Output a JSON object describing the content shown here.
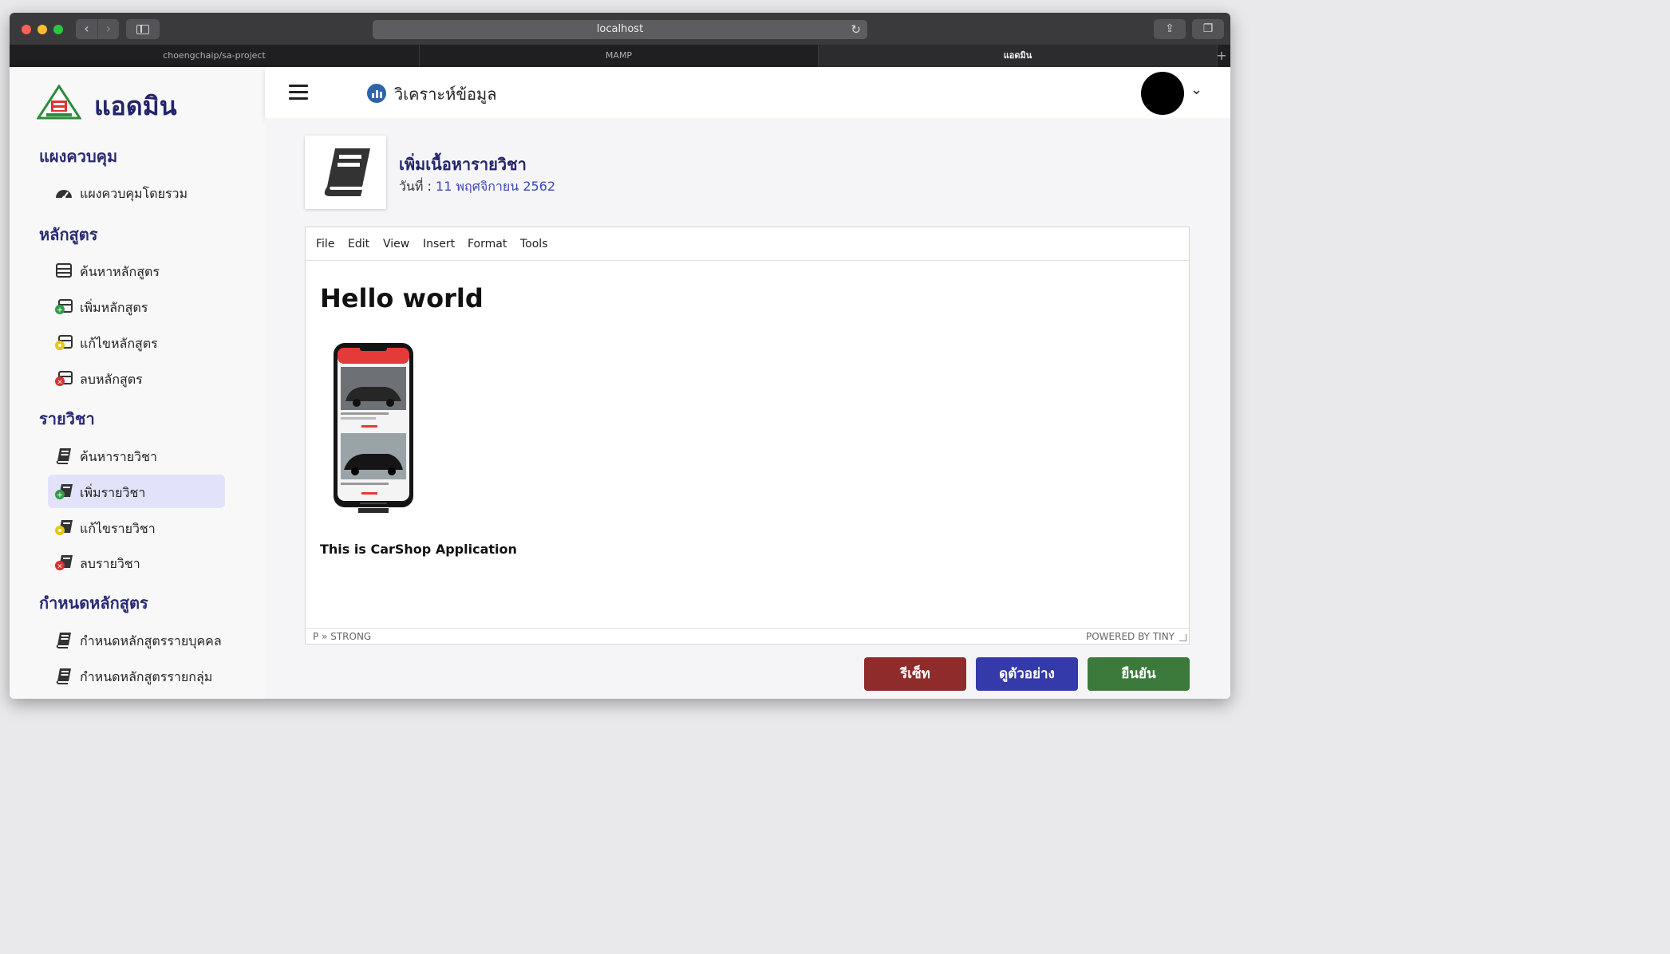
{
  "browser": {
    "url": "localhost",
    "tabs": [
      {
        "label": "choengchaip/sa-project"
      },
      {
        "label": "MAMP"
      },
      {
        "label": "แอดมิน"
      }
    ]
  },
  "sidebar": {
    "brand": "แอดมิน",
    "sections": [
      {
        "title": "แผงควบคุม",
        "items": [
          {
            "label": "แผงควบคุมโดยรวม",
            "icon": "dashboard-icon"
          }
        ]
      },
      {
        "title": "หลักสูตร",
        "items": [
          {
            "label": "ค้นหาหลักสูตร",
            "icon": "curriculum-list-icon"
          },
          {
            "label": "เพิ่มหลักสูตร",
            "icon": "curriculum-add-icon"
          },
          {
            "label": "แก้ไขหลักสูตร",
            "icon": "curriculum-edit-icon"
          },
          {
            "label": "ลบหลักสูตร",
            "icon": "curriculum-delete-icon"
          }
        ]
      },
      {
        "title": "รายวิชา",
        "items": [
          {
            "label": "ค้นหารายวิชา",
            "icon": "book-icon"
          },
          {
            "label": "เพิ่มรายวิชา",
            "icon": "book-add-icon",
            "active": true
          },
          {
            "label": "แก้ไขรายวิชา",
            "icon": "book-edit-icon"
          },
          {
            "label": "ลบรายวิชา",
            "icon": "book-delete-icon"
          }
        ]
      },
      {
        "title": "กำหนดหลักสูตร",
        "items": [
          {
            "label": "กำหนดหลักสูตรรายบุคคล",
            "icon": "book-icon"
          },
          {
            "label": "กำหนดหลักสูตรรายกลุ่ม",
            "icon": "book-icon"
          }
        ]
      }
    ]
  },
  "topnav": {
    "page_title": "วิเคราะห์ข้อมูล",
    "page_icon": "analytics-icon"
  },
  "header": {
    "title": "เพิ่มเนื้อหารายวิชา",
    "date_label": "วันที่ : ",
    "date_value": "11 พฤศจิกายน 2562"
  },
  "editor": {
    "menu": [
      "File",
      "Edit",
      "View",
      "Insert",
      "Format",
      "Tools"
    ],
    "heading": "Hello world",
    "paragraph": "This  is CarShop Application",
    "status_path": "P » STRONG",
    "powered": "POWERED BY TINY"
  },
  "actions": {
    "reset": "รีเซ็ท",
    "preview": "ดูตัวอย่าง",
    "confirm": "ยืนยัน"
  },
  "colors": {
    "brand_text": "#24246b",
    "active_item_bg": "#e2e3fa",
    "reset": "#8f2b2b",
    "preview": "#343aaa",
    "confirm": "#3c7a3c"
  }
}
